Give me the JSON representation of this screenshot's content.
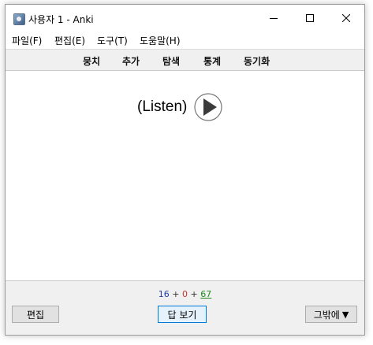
{
  "window": {
    "title": "사용자 1 - Anki",
    "icon": "anki-app-icon"
  },
  "menubar": {
    "items": [
      "파일(F)",
      "편집(E)",
      "도구(T)",
      "도움말(H)"
    ]
  },
  "toolbar": {
    "items": [
      "뭉치",
      "추가",
      "탐색",
      "통계",
      "동기화"
    ]
  },
  "card": {
    "text": "(Listen)",
    "play_icon": "play-icon"
  },
  "counts": {
    "new": "16",
    "sep1": " + ",
    "learning": "0",
    "sep2": " + ",
    "review": "67",
    "colors": {
      "new": "#1f3fa6",
      "learning": "#c0392b",
      "review": "#1e8a1e"
    }
  },
  "buttons": {
    "edit": "편집",
    "show_answer": "답 보기",
    "more": "그밖에",
    "more_arrow": "▼"
  }
}
